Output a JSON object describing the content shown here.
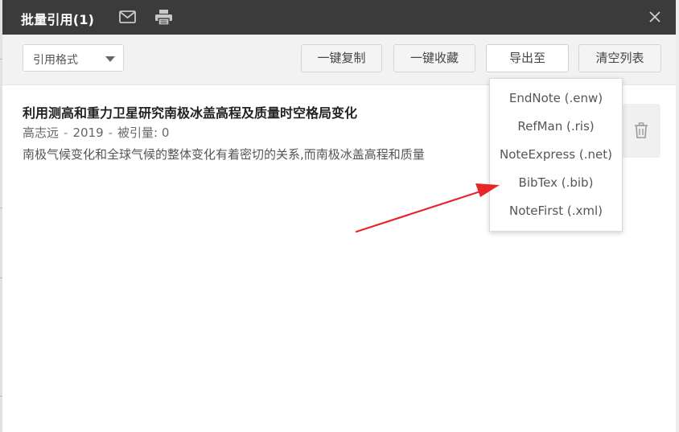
{
  "dialog": {
    "title": "批量引用(1)",
    "icons": [
      "mail-icon",
      "print-icon",
      "close-icon"
    ]
  },
  "toolbar": {
    "citation_format": "引用格式",
    "copy_label": "一键复制",
    "collect_label": "一键收藏",
    "export_label": "导出至",
    "clear_label": "清空列表"
  },
  "export_menu": {
    "options": [
      "EndNote (.enw)",
      "RefMan (.ris)",
      "NoteExpress (.net)",
      "BibTex (.bib)",
      "NoteFirst (.xml)"
    ]
  },
  "items": [
    {
      "title": "利用测高和重力卫星研究南极冰盖高程及质量时空格局变化",
      "author": "高志远",
      "year": "2019",
      "citations": "被引量: 0",
      "description": "南极气候变化和全球气候的整体变化有着密切的关系,而南极冰盖高程和质量"
    }
  ],
  "colors": {
    "titlebar": "#3b3b3b",
    "toolbar": "#f2f2f2",
    "annotation_arrow": "#e8262a"
  }
}
